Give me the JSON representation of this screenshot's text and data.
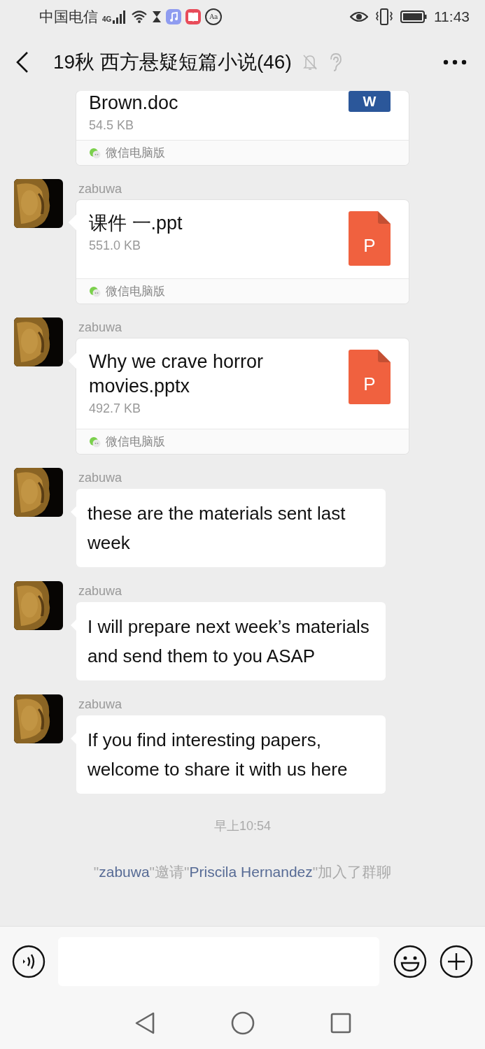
{
  "status_bar": {
    "carrier": "中国电信",
    "network": "4G",
    "app_icon_text": "Aa",
    "time": "11:43"
  },
  "header": {
    "title": "19秋 西方悬疑短篇小说(46)",
    "muted": true
  },
  "messages": [
    {
      "kind": "file",
      "file_name": "Brown.doc",
      "file_size": "54.5 KB",
      "color": "#2b579a",
      "icon_letter": "W",
      "source": "微信电脑版"
    },
    {
      "kind": "file",
      "sender": "zabuwa",
      "file_name": "课件 一.ppt",
      "file_size": "551.0 KB",
      "color": "#f0613f",
      "icon_letter": "P",
      "source": "微信电脑版"
    },
    {
      "kind": "file",
      "sender": "zabuwa",
      "file_name": "Why we crave horror movies.pptx",
      "file_size": "492.7 KB",
      "color": "#f0613f",
      "icon_letter": "P",
      "source": "微信电脑版"
    },
    {
      "kind": "text",
      "sender": "zabuwa",
      "text": "these are the materials sent last week"
    },
    {
      "kind": "text",
      "sender": "zabuwa",
      "text": "I will prepare next week’s materials and send them to you ASAP"
    },
    {
      "kind": "text",
      "sender": "zabuwa",
      "text": "If you find interesting papers, welcome to share it with us here"
    },
    {
      "kind": "time",
      "text": "早上10:54"
    },
    {
      "kind": "system",
      "parts": [
        {
          "text": "\"",
          "link": false
        },
        {
          "text": "zabuwa",
          "link": true
        },
        {
          "text": "\"邀请\"",
          "link": false
        },
        {
          "text": "Priscila Hernandez",
          "link": true
        },
        {
          "text": "\"加入了群聊",
          "link": false
        }
      ]
    }
  ]
}
